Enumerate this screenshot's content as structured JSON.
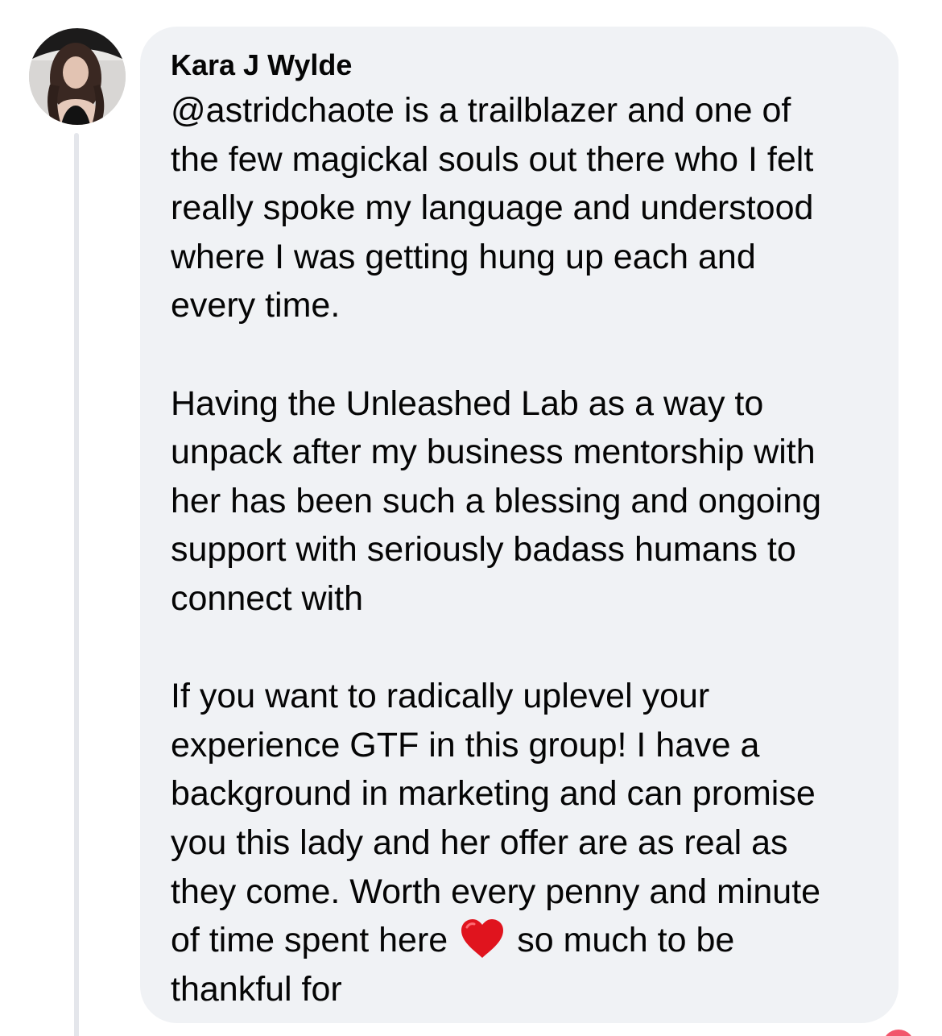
{
  "comment": {
    "author": "Kara J Wylde",
    "avatar_icon": "profile-photo",
    "paragraphs": [
      {
        "lines": [
          "@astridchaote is a trailblazer and one of",
          "the few magickal souls out there who I felt",
          "really spoke my language and understood",
          "where I was getting hung up each and",
          "every time."
        ]
      },
      {
        "lines": [
          "Having the Unleashed Lab as a way to",
          "unpack after my business mentorship with",
          "her has been such a blessing and ongoing",
          "support with seriously badass humans to",
          "connect with"
        ]
      },
      {
        "lines": [
          "If you want to radically uplevel your",
          "experience GTF in this group! I have a",
          "background in marketing and can promise",
          "you this lady and her offer are as real as",
          "they come. Worth every penny and minute"
        ],
        "emoji_line": {
          "before": "of time spent here",
          "emoji": "red-heart-icon",
          "after": "so much to be"
        },
        "final_line": "thankful for"
      }
    ]
  },
  "colors": {
    "bubble_bg": "#f0f2f5",
    "thread_line": "#e4e6eb",
    "text": "#050505",
    "heart": "#e0141e",
    "reaction_dot": "#f2556b"
  }
}
